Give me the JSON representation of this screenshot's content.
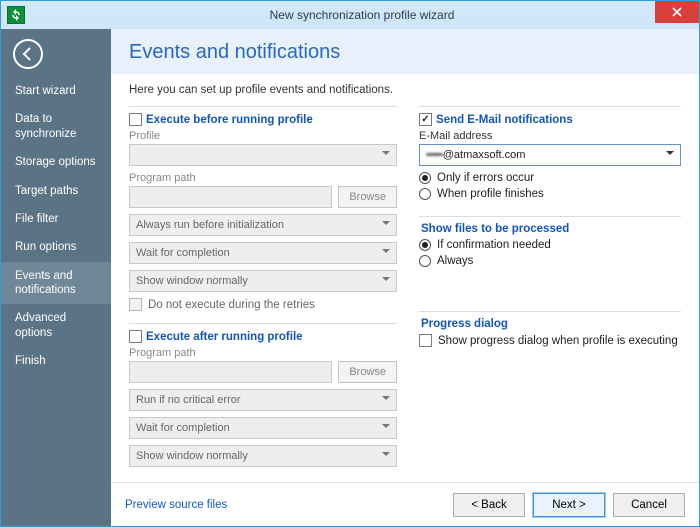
{
  "window": {
    "title": "New synchronization profile wizard"
  },
  "sidebar": {
    "items": [
      {
        "label": "Start wizard"
      },
      {
        "label": "Data to synchronize"
      },
      {
        "label": "Storage options"
      },
      {
        "label": "Target paths"
      },
      {
        "label": "File filter"
      },
      {
        "label": "Run options"
      },
      {
        "label": "Events and notifications"
      },
      {
        "label": "Advanced options"
      },
      {
        "label": "Finish"
      }
    ],
    "active_index": 6
  },
  "header": {
    "title": "Events and notifications"
  },
  "intro": "Here you can set up profile events and notifications.",
  "before": {
    "title": "Execute before running profile",
    "checked": false,
    "profile_label": "Profile",
    "profile_value": "",
    "program_label": "Program path",
    "program_value": "",
    "browse": "Browse",
    "when": "Always run before initialization",
    "wait": "Wait for completion",
    "show": "Show window normally",
    "skip_retries": "Do not execute during the retries",
    "skip_retries_checked": false
  },
  "after": {
    "title": "Execute after running profile",
    "checked": false,
    "program_label": "Program path",
    "program_value": "",
    "browse": "Browse",
    "when": "Run if no critical error",
    "wait": "Wait for completion",
    "show": "Show window normally"
  },
  "email": {
    "title": "Send E-Mail notifications",
    "checked": true,
    "addr_label": "E-Mail address",
    "addr_local": "•••••",
    "addr_domain": "@atmaxsoft.com",
    "only_errors": "Only if errors occur",
    "when_finishes": "When profile finishes",
    "selected": "only_errors"
  },
  "show_files": {
    "title": "Show files to be processed",
    "if_confirm": "If confirmation needed",
    "always": "Always",
    "selected": "if_confirm"
  },
  "progress": {
    "title": "Progress dialog",
    "show_label": "Show progress dialog when profile is executing",
    "checked": false
  },
  "footer": {
    "preview": "Preview source files",
    "back": "< Back",
    "next": "Next >",
    "cancel": "Cancel"
  }
}
